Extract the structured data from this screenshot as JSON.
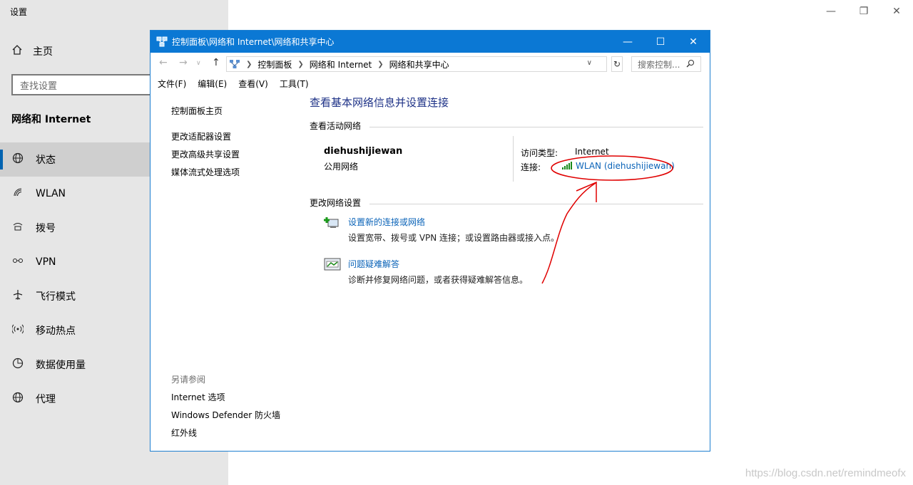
{
  "settings": {
    "title": "设置",
    "home": "主页",
    "search_placeholder": "查找设置",
    "section": "网络和 Internet",
    "nav": [
      {
        "label": "状态",
        "icon": "globe-icon",
        "active": true
      },
      {
        "label": "WLAN",
        "icon": "wifi-icon",
        "active": false
      },
      {
        "label": "拨号",
        "icon": "dialup-icon",
        "active": false
      },
      {
        "label": "VPN",
        "icon": "vpn-icon",
        "active": false
      },
      {
        "label": "飞行模式",
        "icon": "airplane-icon",
        "active": false
      },
      {
        "label": "移动热点",
        "icon": "hotspot-icon",
        "active": false
      },
      {
        "label": "数据使用量",
        "icon": "data-usage-icon",
        "active": false
      },
      {
        "label": "代理",
        "icon": "proxy-globe-icon",
        "active": false
      }
    ]
  },
  "cp": {
    "title": "控制面板\\网络和 Internet\\网络和共享中心",
    "breadcrumbs": [
      "控制面板",
      "网络和 Internet",
      "网络和共享中心"
    ],
    "search_placeholder": "搜索控制...",
    "menu": [
      "文件(F)",
      "编辑(E)",
      "查看(V)",
      "工具(T)"
    ],
    "left_links": [
      "控制面板主页",
      "更改适配器设置",
      "更改高级共享设置",
      "媒体流式处理选项"
    ],
    "see_also_label": "另请参阅",
    "see_also": [
      "Internet 选项",
      "Windows Defender 防火墙",
      "红外线"
    ],
    "heading": "查看基本网络信息并设置连接",
    "active_networks_label": "查看活动网络",
    "network_name": "diehushijiewan",
    "network_type": "公用网络",
    "access_type_label": "访问类型:",
    "access_type_value": "Internet",
    "connection_label": "连接:",
    "connection_value": "WLAN (diehushijiewan)",
    "change_settings_label": "更改网络设置",
    "tasks": [
      {
        "title": "设置新的连接或网络",
        "desc": "设置宽带、拨号或 VPN 连接；或设置路由器或接入点。",
        "icon": "new-connection-icon"
      },
      {
        "title": "问题疑难解答",
        "desc": "诊断并修复网络问题，或者获得疑难解答信息。",
        "icon": "troubleshoot-icon"
      }
    ]
  },
  "watermark": "https://blog.csdn.net/remindmeofx",
  "colors": {
    "accent": "#0b78d4",
    "link": "#0a63b8",
    "heading": "#1e3287",
    "annotation": "#e00000"
  }
}
